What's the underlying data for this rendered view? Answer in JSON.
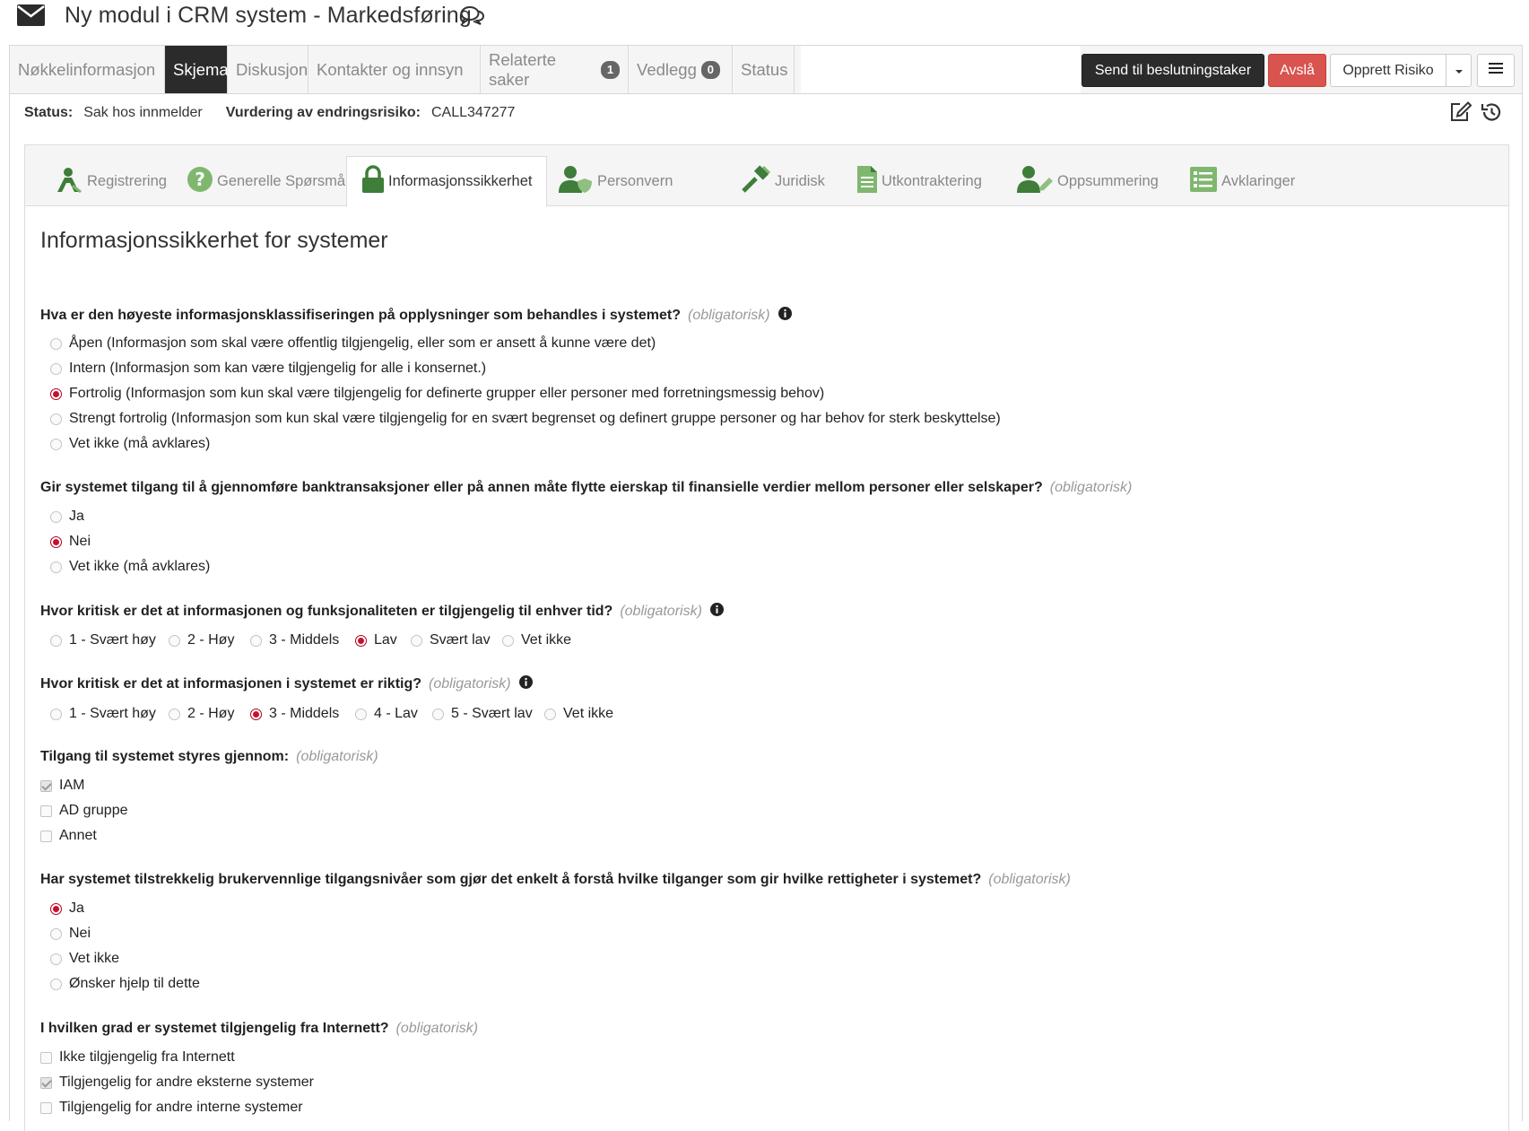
{
  "header": {
    "title": "Ny modul i CRM system - Markedsføring"
  },
  "topnav": {
    "tabs": [
      {
        "label": "Nøkkelinformasjon"
      },
      {
        "label": "Skjema"
      },
      {
        "label": "Diskusjon"
      },
      {
        "label": "Kontakter og innsyn"
      },
      {
        "label": "Relaterte saker",
        "badge": "1"
      },
      {
        "label": "Vedlegg",
        "badge": "0"
      },
      {
        "label": "Status"
      }
    ],
    "buttons": {
      "send": "Send til beslutningstaker",
      "reject": "Avslå",
      "risk": "Opprett Risiko"
    }
  },
  "status": {
    "status_label": "Status:",
    "status_value": "Sak hos innmelder",
    "risk_label": "Vurdering av endringsrisiko:",
    "risk_value": "CALL347277"
  },
  "subtabs": [
    {
      "label": "Registrering"
    },
    {
      "label": "Generelle Spørsmål"
    },
    {
      "label": "Informasjonssikkerhet"
    },
    {
      "label": "Personvern"
    },
    {
      "label": "Juridisk"
    },
    {
      "label": "Utkontraktering"
    },
    {
      "label": "Oppsummering"
    },
    {
      "label": "Avklaringer"
    }
  ],
  "form": {
    "title": "Informasjonssikkerhet for systemer",
    "required_label": "(obligatorisk)",
    "questions": [
      {
        "text": "Hva er den høyeste informasjonsklassifiseringen på opplysninger som behandles i systemet?",
        "options": [
          "Åpen (Informasjon som skal være offentlig tilgjengelig, eller som er ansett å kunne være det)",
          "Intern (Informasjon som kan være tilgjengelig for alle i konsernet.)",
          "Fortrolig (Informasjon som kun skal være tilgjengelig for definerte grupper eller personer med forretningsmessig behov)",
          "Strengt fortrolig (Informasjon som kun skal være tilgjengelig for en svært begrenset og definert gruppe personer og har behov for sterk beskyttelse)",
          "Vet ikke (må avklares)"
        ],
        "selected": 2
      },
      {
        "text": "Gir systemet tilgang til å gjennomføre banktransaksjoner eller på annen måte flytte eierskap til finansielle verdier mellom personer eller selskaper?",
        "options": [
          "Ja",
          "Nei",
          "Vet ikke (må avklares)"
        ],
        "selected": 1
      },
      {
        "text": "Hvor kritisk er det at informasjonen og funksjonaliteten er tilgjengelig til enhver tid?",
        "options": [
          "1 - Svært høy",
          "2 - Høy",
          "3 - Middels",
          "Lav",
          "Svært lav",
          "Vet ikke"
        ],
        "selected": 3
      },
      {
        "text": "Hvor kritisk er det at informasjonen i systemet er riktig?",
        "options": [
          "1 - Svært høy",
          "2 - Høy",
          "3 - Middels",
          "4 - Lav",
          "5 - Svært lav",
          "Vet ikke"
        ],
        "selected": 2
      },
      {
        "text": "Tilgang til systemet styres gjennom:",
        "options": [
          "IAM",
          "AD gruppe",
          "Annet"
        ],
        "checked": [
          true,
          false,
          false
        ]
      },
      {
        "text": "Har systemet tilstrekkelig brukervennlige tilgangsnivåer som gjør det enkelt å forstå hvilke tilganger som gir hvilke rettigheter i systemet?",
        "options": [
          "Ja",
          "Nei",
          "Vet ikke",
          "Ønsker hjelp til dette"
        ],
        "selected": 0
      },
      {
        "text": "I hvilken grad er systemet tilgjengelig fra Internett?",
        "options": [
          "Ikke tilgjengelig fra Internett",
          "Tilgjengelig for andre eksterne systemer",
          "Tilgjengelig for andre interne systemer"
        ],
        "checked": [
          false,
          true,
          false
        ]
      }
    ]
  },
  "colors": {
    "accent_green": "#3f7d3a",
    "dark": "#2b2b2b",
    "danger": "#d9534f",
    "radio_selected": "#c8102e"
  }
}
